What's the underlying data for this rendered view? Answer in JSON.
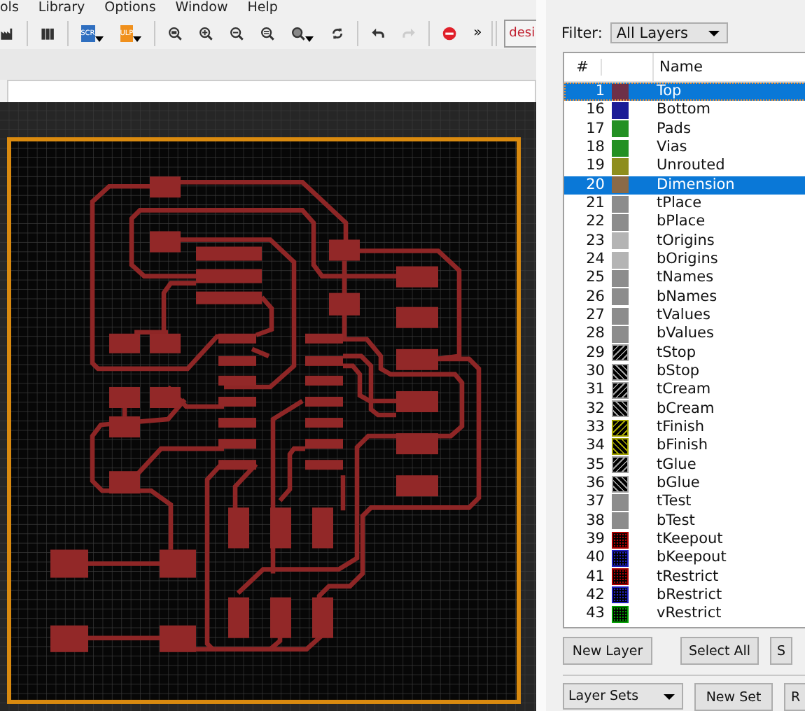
{
  "menu": [
    "ols",
    "Library",
    "Options",
    "Window",
    "Help"
  ],
  "toolbar": {
    "script_label": "SCR",
    "ulp_label": "ULP",
    "overflow": "»",
    "design_link": "desi"
  },
  "layers_panel": {
    "filter_label": "Filter:",
    "filter_value": "All Layers",
    "columns": [
      {
        "label": "#"
      },
      {
        "label": "Name"
      }
    ],
    "layers": [
      {
        "number": "1",
        "name": "Top",
        "color": "#6e3048",
        "kind": "solid",
        "selected": true
      },
      {
        "number": "16",
        "name": "Bottom",
        "color": "#1c1c96",
        "kind": "solid",
        "selected": false
      },
      {
        "number": "17",
        "name": "Pads",
        "color": "#239023",
        "kind": "solid",
        "selected": false
      },
      {
        "number": "18",
        "name": "Vias",
        "color": "#239023",
        "kind": "solid",
        "selected": false
      },
      {
        "number": "19",
        "name": "Unrouted",
        "color": "#8e8e1e",
        "kind": "solid",
        "selected": false
      },
      {
        "number": "20",
        "name": "Dimension",
        "color": "#8a6a48",
        "kind": "solid",
        "selected": true
      },
      {
        "number": "21",
        "name": "tPlace",
        "color": "#8c8c8c",
        "kind": "solid",
        "selected": false
      },
      {
        "number": "22",
        "name": "bPlace",
        "color": "#8c8c8c",
        "kind": "solid",
        "selected": false
      },
      {
        "number": "23",
        "name": "tOrigins",
        "color": "#b4b4b4",
        "kind": "solid",
        "selected": false
      },
      {
        "number": "24",
        "name": "bOrigins",
        "color": "#b4b4b4",
        "kind": "solid",
        "selected": false
      },
      {
        "number": "25",
        "name": "tNames",
        "color": "#8c8c8c",
        "kind": "solid",
        "selected": false
      },
      {
        "number": "26",
        "name": "bNames",
        "color": "#8c8c8c",
        "kind": "solid",
        "selected": false
      },
      {
        "number": "27",
        "name": "tValues",
        "color": "#8c8c8c",
        "kind": "solid",
        "selected": false
      },
      {
        "number": "28",
        "name": "bValues",
        "color": "#8c8c8c",
        "kind": "solid",
        "selected": false
      },
      {
        "number": "29",
        "name": "tStop",
        "color": "#a0a0a0",
        "kind": "hatch",
        "selected": false
      },
      {
        "number": "30",
        "name": "bStop",
        "color": "#a0a0a0",
        "kind": "backhatch",
        "selected": false
      },
      {
        "number": "31",
        "name": "tCream",
        "color": "#a0a0a0",
        "kind": "hatch",
        "selected": false
      },
      {
        "number": "32",
        "name": "bCream",
        "color": "#a0a0a0",
        "kind": "backhatch",
        "selected": false
      },
      {
        "number": "33",
        "name": "tFinish",
        "color": "#a0a000",
        "kind": "hatch",
        "selected": false
      },
      {
        "number": "34",
        "name": "bFinish",
        "color": "#a0a000",
        "kind": "backhatch",
        "selected": false
      },
      {
        "number": "35",
        "name": "tGlue",
        "color": "#a0a0a0",
        "kind": "hatch",
        "selected": false
      },
      {
        "number": "36",
        "name": "bGlue",
        "color": "#a0a0a0",
        "kind": "backhatch",
        "selected": false
      },
      {
        "number": "37",
        "name": "tTest",
        "color": "#8c8c8c",
        "kind": "solid",
        "selected": false
      },
      {
        "number": "38",
        "name": "bTest",
        "color": "#8c8c8c",
        "kind": "solid",
        "selected": false
      },
      {
        "number": "39",
        "name": "tKeepout",
        "color": "#b00000",
        "kind": "dots",
        "selected": false
      },
      {
        "number": "40",
        "name": "bKeepout",
        "color": "#2020c0",
        "kind": "dots",
        "selected": false
      },
      {
        "number": "41",
        "name": "tRestrict",
        "color": "#b00000",
        "kind": "dots",
        "selected": false
      },
      {
        "number": "42",
        "name": "bRestrict",
        "color": "#2020c0",
        "kind": "dots",
        "selected": false
      },
      {
        "number": "43",
        "name": "vRestrict",
        "color": "#00a000",
        "kind": "dots",
        "selected": false
      }
    ],
    "buttons": [
      "New Layer",
      "Select All",
      "S"
    ],
    "layer_sets": "Layer Sets",
    "set_buttons": [
      "New Set",
      "R"
    ]
  }
}
